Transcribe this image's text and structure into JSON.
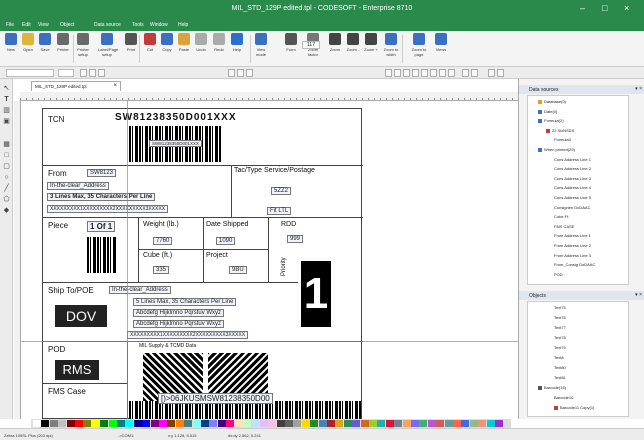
{
  "window": {
    "title": "MIL_STD_129P edited.tpl - CODESOFT - Enterprise 8710"
  },
  "menu": [
    "File",
    "Edit",
    "View",
    "Object",
    "Data source",
    "Tools",
    "Window",
    "Help"
  ],
  "ribbon": [
    {
      "label": "New",
      "color": "#3b6fc2"
    },
    {
      "label": "Open",
      "color": "#e2b33c"
    },
    {
      "label": "Save",
      "color": "#3b6fc2"
    },
    {
      "label": "Printer",
      "color": "#6a6a6a"
    },
    {
      "label": "Printer setup",
      "color": "#6a6a6a"
    },
    {
      "label": "Label/Page setup",
      "color": "#3b6fc2"
    },
    {
      "label": "Print",
      "color": "#555"
    },
    {
      "label": "Cut",
      "color": "#c23b3b"
    },
    {
      "label": "Copy",
      "color": "#3b6fc2"
    },
    {
      "label": "Paste",
      "color": "#d9a43c"
    },
    {
      "label": "Undo",
      "color": "#aaaaaa"
    },
    {
      "label": "Redo",
      "color": "#aaaaaa"
    },
    {
      "label": "Help",
      "color": "#2a6fd1"
    },
    {
      "label": "View mode",
      "color": "#3b6fc2"
    },
    {
      "label": "Form",
      "color": "#555"
    },
    {
      "label": "Zoom factor",
      "color": "#777"
    },
    {
      "label": "Zoom",
      "color": "#444"
    },
    {
      "label": "Zoom -",
      "color": "#444"
    },
    {
      "label": "Zoom +",
      "color": "#444"
    },
    {
      "label": "Zoom to width",
      "color": "#3b6fc2"
    },
    {
      "label": "Zoom to page",
      "color": "#3b6fc2"
    },
    {
      "label": "Views",
      "color": "#3b6fc2"
    }
  ],
  "zoom_value": "117",
  "doc_tab": "MIL_STD_129P edited.tpl",
  "label": {
    "tcn": "TCN",
    "tcn_barcode_text": "SW81238350D001XXX",
    "tcn_barcode_sub": "SW81238350D001XXX",
    "from": "From",
    "from_value": "SW8123",
    "tac_type": "Tac/Type Service/Postage",
    "tac_value": "5ZZ2",
    "in_clear": "In-the-clear_Address",
    "three_lines": "3 Lines Max, 35 Characters Per Line",
    "xline": "XXXXXXXXX1XXXXXXXXX2XXXXXXXXX3XXXXX",
    "fit_ltl": "Fit LTL",
    "piece": "Piece",
    "piece_value": "1 Of 1",
    "weight": "Weight (lb.)",
    "weight_value": "7760",
    "date_shipped": "Date Shipped",
    "date_value": "1090",
    "rdd": "RDD",
    "rdd_value": "999",
    "cube": "Cube (ft.)",
    "cube_value": "335",
    "project": "Project",
    "project_value": "9BU",
    "priority": "Priority",
    "priority_value": "1",
    "ship_to": "Ship To/POE",
    "ship_to_value": "In-the-clear_Address",
    "five_lines": "5 Lines Max, 35 Characters Per Line",
    "abcdef1": "Abcdefg Hijklmno Pqrstuv Wxyz",
    "abcdef2": "Abcdefg Hijklmno Pqrstuv Wxyz",
    "xline2": "XXXXXXXXX1XXXXXXXXX2XXXXXXXXX3XXXXX",
    "dov": "DOV",
    "pod": "POD",
    "mil_supply": "MIL Supply & TCMD Data",
    "rms": "RMS",
    "fms_case": "FMS Case",
    "bottom_barcode_text": "[)>06JKUSMSW81238350D00"
  },
  "data_sources": {
    "title": "Data sources",
    "items": [
      {
        "label": "Database(0)",
        "indent": 1,
        "color": "#e0a020"
      },
      {
        "label": "Date(0)",
        "indent": 1,
        "color": "#3b6fc2"
      },
      {
        "label": "Formula(2)",
        "indent": 1,
        "color": "#3b6fc2"
      },
      {
        "label": "22 SixNSDS",
        "indent": 2,
        "color": "#c23b3b"
      },
      {
        "label": "Formula3",
        "indent": 3,
        "color": ""
      },
      {
        "label": "When printed(29)",
        "indent": 1,
        "color": "#3b6fc2"
      },
      {
        "label": "Cons Address Line 1",
        "indent": 3,
        "color": ""
      },
      {
        "label": "Cons Address Line 2",
        "indent": 3,
        "color": ""
      },
      {
        "label": "Cons Address Line 3",
        "indent": 3,
        "color": ""
      },
      {
        "label": "Cons Address Line 4",
        "indent": 3,
        "color": ""
      },
      {
        "label": "Cons Address Line 5",
        "indent": 3,
        "color": ""
      },
      {
        "label": "Consignee DoDAAC",
        "indent": 3,
        "color": ""
      },
      {
        "label": "Cube Ft.",
        "indent": 3,
        "color": ""
      },
      {
        "label": "FMS CASE",
        "indent": 3,
        "color": ""
      },
      {
        "label": "From Address Line 1",
        "indent": 3,
        "color": ""
      },
      {
        "label": "From Address Line 2",
        "indent": 3,
        "color": ""
      },
      {
        "label": "From Address Line 3",
        "indent": 3,
        "color": ""
      },
      {
        "label": "From_Consig DoDAAC",
        "indent": 3,
        "color": ""
      },
      {
        "label": "POD",
        "indent": 3,
        "color": ""
      }
    ]
  },
  "objects": {
    "title": "Objects",
    "items": [
      {
        "label": "Text75",
        "indent": 3,
        "color": ""
      },
      {
        "label": "Text76",
        "indent": 3,
        "color": ""
      },
      {
        "label": "Text77",
        "indent": 3,
        "color": ""
      },
      {
        "label": "Text78",
        "indent": 3,
        "color": ""
      },
      {
        "label": "Text79",
        "indent": 3,
        "color": ""
      },
      {
        "label": "Text8",
        "indent": 3,
        "color": ""
      },
      {
        "label": "Text80",
        "indent": 3,
        "color": ""
      },
      {
        "label": "Text81",
        "indent": 3,
        "color": ""
      },
      {
        "label": "Barcode(16)",
        "indent": 1,
        "color": "#555"
      },
      {
        "label": "Barcode10",
        "indent": 3,
        "color": ""
      },
      {
        "label": "Barcode11 Copy(1)",
        "indent": 3,
        "color": "#c23b3b"
      }
    ]
  },
  "status": {
    "left": "Zebra 105SL Plus (203 dpi)",
    "port": "->COM1:",
    "pos": "x:y 1.128, 5.515",
    "size": "dx:dy 2.562, 5.241"
  },
  "palette": [
    "#ffffff",
    "#000000",
    "#7f7f7f",
    "#c0c0c0",
    "#800000",
    "#ff0000",
    "#808000",
    "#ffff00",
    "#008000",
    "#00ff00",
    "#008080",
    "#00ffff",
    "#000080",
    "#0000ff",
    "#800080",
    "#ff00ff",
    "#804000",
    "#ff8000",
    "#408080",
    "#80ffff",
    "#004080",
    "#8080ff",
    "#400080",
    "#ff0080",
    "#ffe0c0",
    "#c0ffc0",
    "#c0e0ff",
    "#e0c0ff",
    "#ffc0e0",
    "#404040",
    "#606060",
    "#a0a0a0",
    "#ffd700",
    "#228b22",
    "#4682b4",
    "#b22222",
    "#daa520",
    "#2e8b57",
    "#6a5acd",
    "#d2691e",
    "#9acd32",
    "#20b2aa",
    "#dc143c",
    "#708090",
    "#f4a460",
    "#7b68ee",
    "#3cb371",
    "#ba55d3",
    "#cd5c5c",
    "#5f9ea0",
    "#ff6347",
    "#4169e1",
    "#8fbc8f",
    "#e9967a",
    "#00ced1",
    "#9932cc"
  ]
}
